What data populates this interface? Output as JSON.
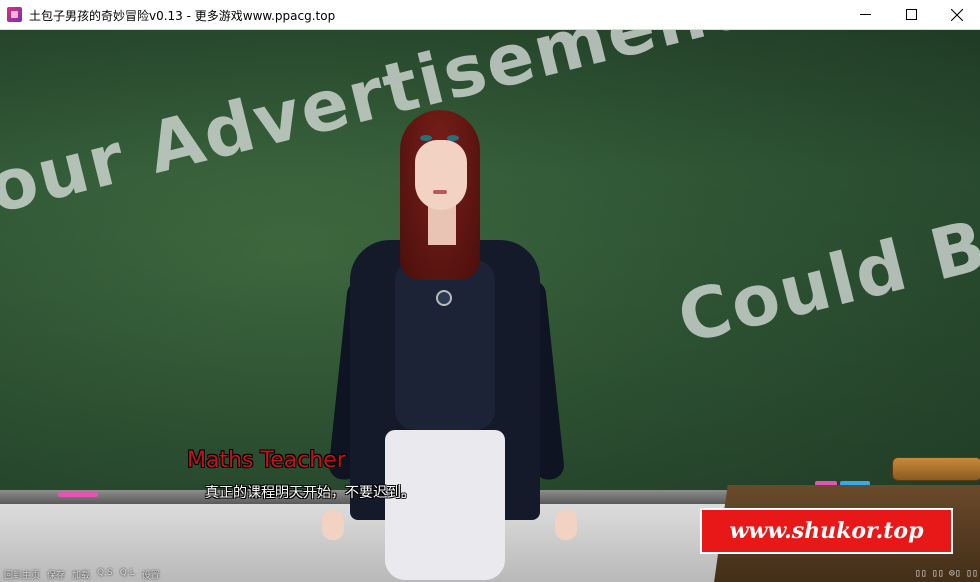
{
  "window": {
    "title": "土包子男孩的奇妙冒险v0.13 - 更多游戏www.ppacg.top",
    "icons": [
      "app-icon",
      "minimize-icon",
      "maximize-icon",
      "close-icon"
    ]
  },
  "scene": {
    "chalkboard_text_1": "our Advertisement",
    "chalkboard_text_2": "Could B"
  },
  "dialogue": {
    "speaker": "Maths Teacher",
    "text": "真正的课程明天开始，不要迟到。",
    "speaker_color": "#c4121d"
  },
  "watermark": {
    "text": "www.shukor.top",
    "background": "#e81818"
  },
  "quick_menu": [
    "回到主页",
    "保存",
    "加载",
    "Q.S",
    "Q.L",
    "设置"
  ],
  "bottom_icons": [
    "▯▯",
    "▯▯",
    "⊙▯",
    "▯▯"
  ]
}
